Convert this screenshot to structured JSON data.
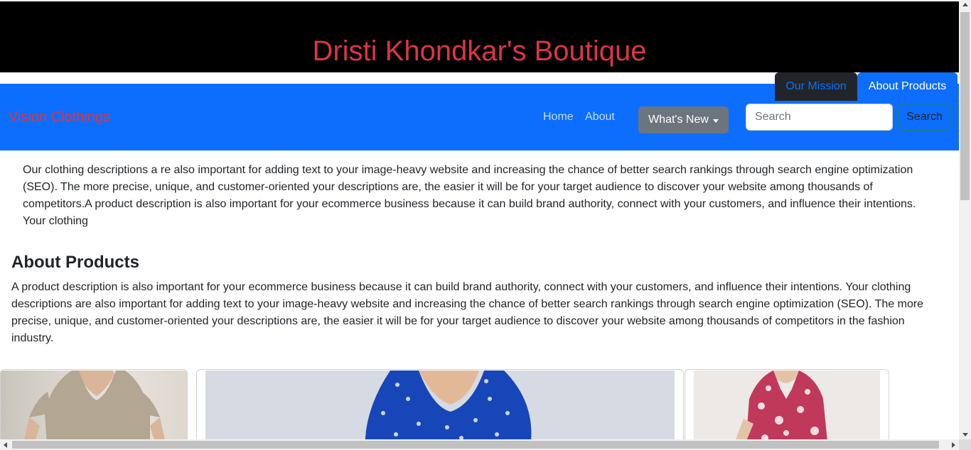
{
  "header": {
    "title": "Dristi Khondkar's Boutique"
  },
  "tabs": [
    {
      "label": "Our Mission"
    },
    {
      "label": "About Products"
    }
  ],
  "navbar": {
    "brand": "Vision Clothings",
    "links": [
      {
        "label": "Home"
      },
      {
        "label": "About"
      }
    ],
    "dropdown_label": "What's New",
    "search_placeholder": "Search",
    "search_button": "Search"
  },
  "content": {
    "intro_paragraph": "Our clothing descriptions a re also important for adding text to your image-heavy website and increasing the chance of better search rankings through search engine optimization (SEO). The more precise, unique, and customer-oriented your descriptions are, the easier it will be for your target audience to discover your website among thousands of competitors.A product description is also important for your ecommerce business because it can build brand authority, connect with your customers, and influence their intentions. Your clothing",
    "section_heading": "About Products",
    "section_paragraph": "A product description is also important for your ecommerce business because it can build brand authority, connect with your customers, and influence their intentions. Your clothing descriptions are also important for adding text to your image-heavy website and increasing the chance of better search rankings through search engine optimization (SEO). The more precise, unique, and customer-oriented your descriptions are, the easier it will be for your target audience to discover your website among thousands of competitors in the fashion industry."
  },
  "cards": [
    {
      "image": "beige-v-neck-dress-photo"
    },
    {
      "image": "blue-floral-wrap-dress-photo"
    },
    {
      "image": "pink-floral-shirt-dress-photo"
    }
  ],
  "colors": {
    "title_red": "#dc3545",
    "navbar_blue": "#0d6efd",
    "tab_dark": "#212529",
    "dropdown_gray": "#6c757d",
    "search_button_border": "#198754"
  }
}
